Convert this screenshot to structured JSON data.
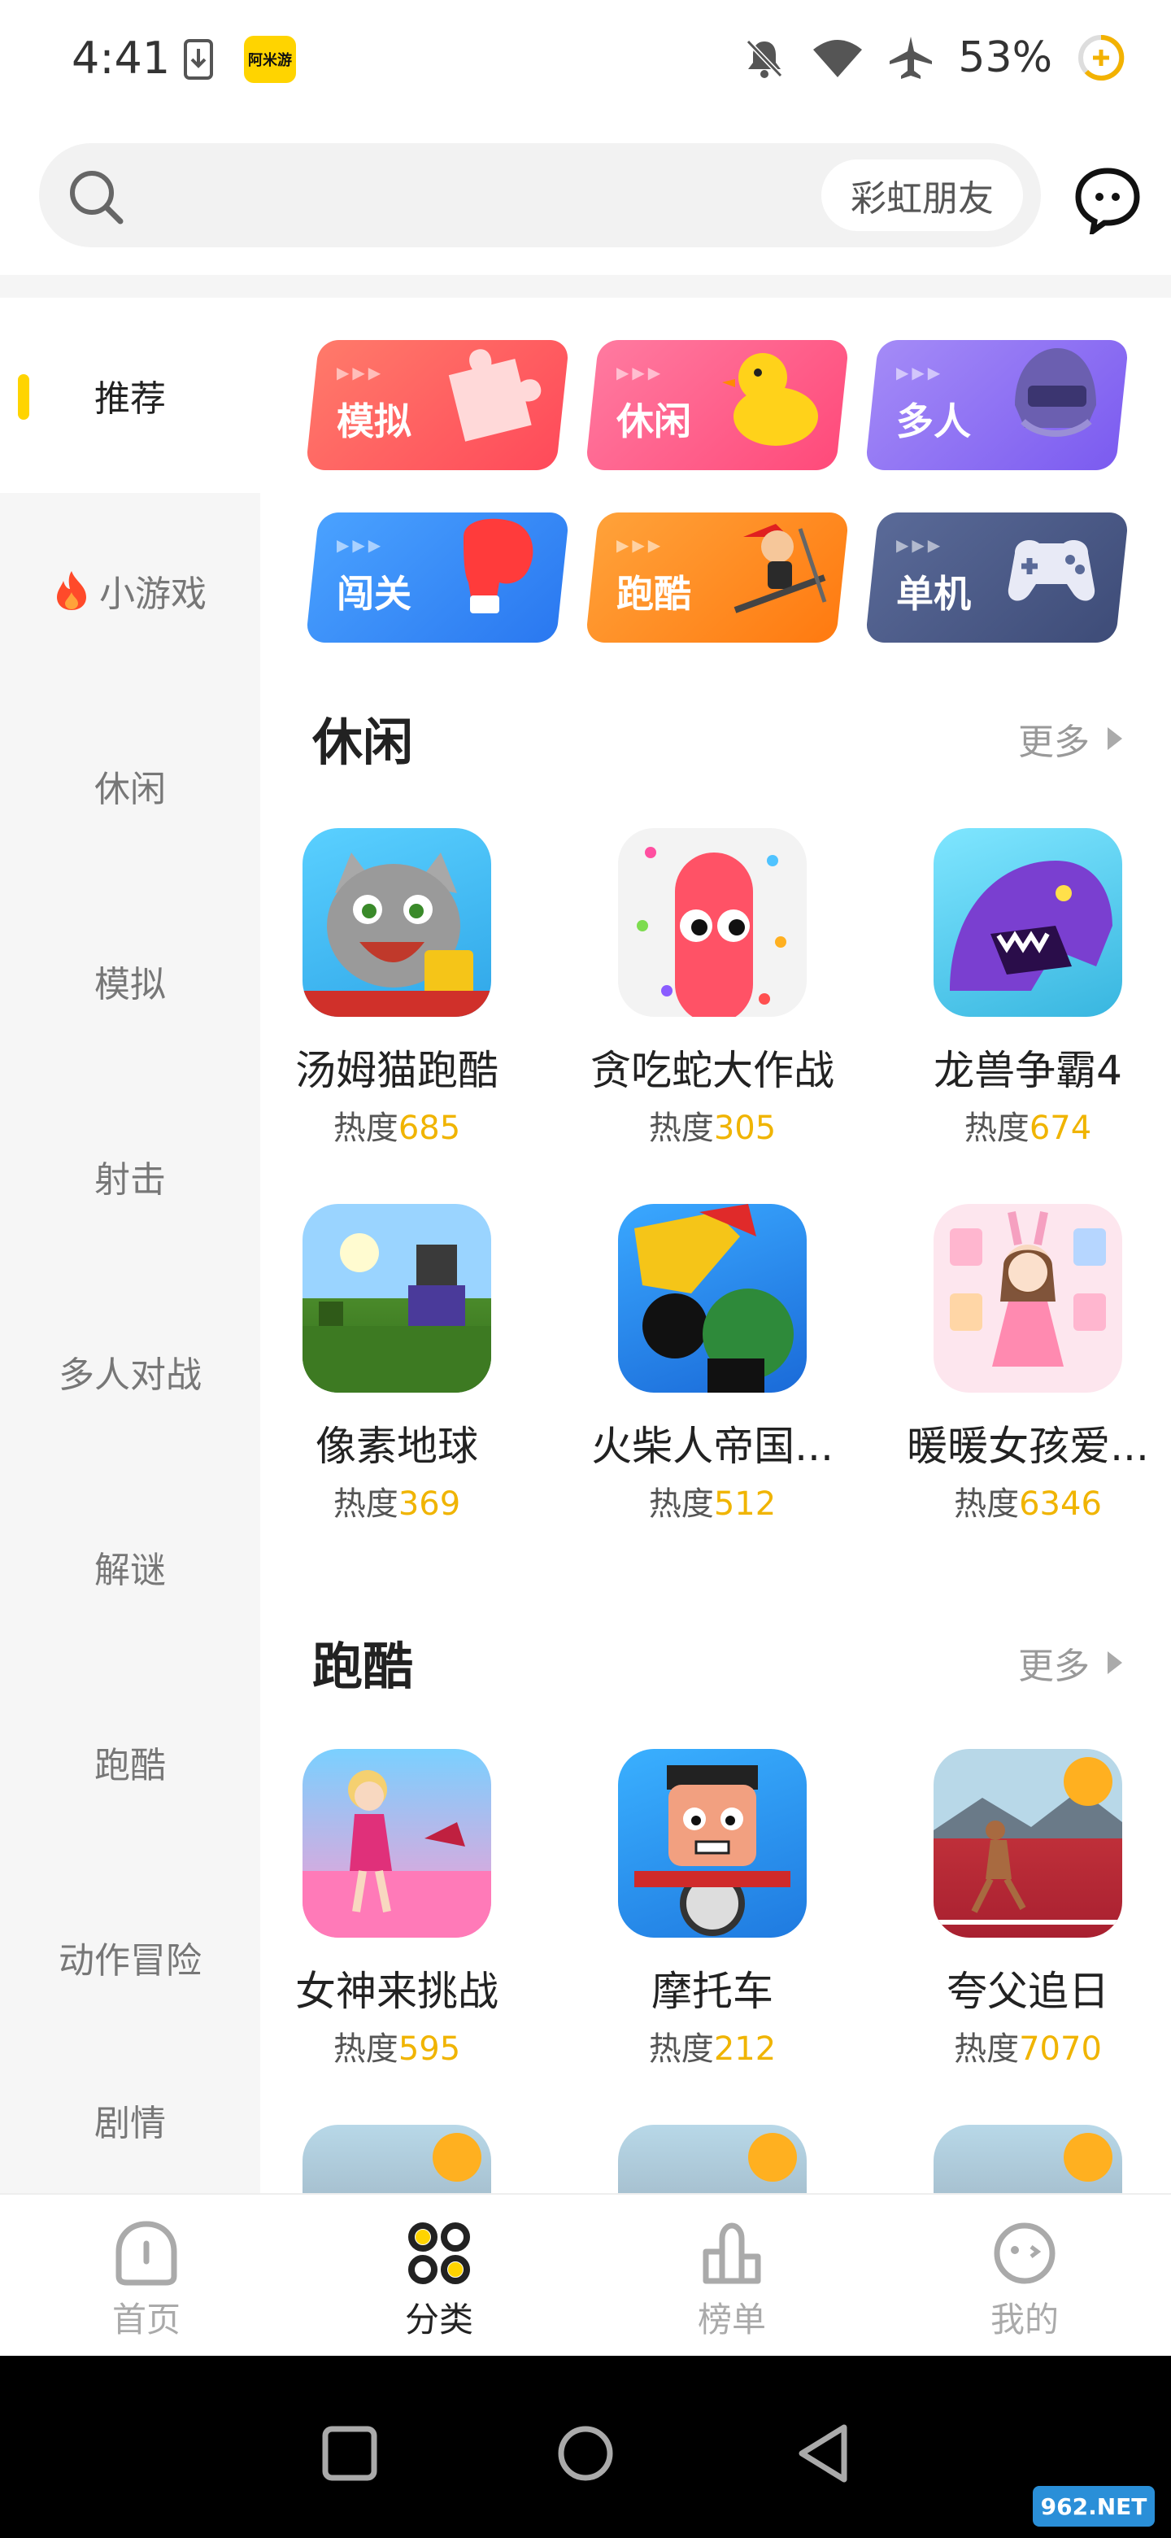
{
  "status": {
    "time": "4:41",
    "app_badge": "阿米游",
    "battery": "53%"
  },
  "search": {
    "chip": "彩虹朋友"
  },
  "sidebar": {
    "items": [
      {
        "label": "推荐"
      },
      {
        "label": "小游戏"
      },
      {
        "label": "休闲"
      },
      {
        "label": "模拟"
      },
      {
        "label": "射击"
      },
      {
        "label": "多人对战"
      },
      {
        "label": "解谜"
      },
      {
        "label": "跑酷"
      },
      {
        "label": "动作冒险"
      },
      {
        "label": "剧情"
      }
    ]
  },
  "tiles": [
    {
      "label": "模拟",
      "color": "#ff5e5e"
    },
    {
      "label": "休闲",
      "color": "#ff5c8a"
    },
    {
      "label": "多人",
      "color": "#8b6cf2"
    },
    {
      "label": "闯关",
      "color": "#2f8cf5"
    },
    {
      "label": "跑酷",
      "color": "#ff8a1f"
    },
    {
      "label": "单机",
      "color": "#4a5a86"
    }
  ],
  "sections": [
    {
      "title": "休闲",
      "more": "更多",
      "games": [
        {
          "name": "汤姆猫跑酷",
          "heat_label": "热度",
          "heat": "685"
        },
        {
          "name": "贪吃蛇大作战",
          "heat_label": "热度",
          "heat": "305"
        },
        {
          "name": "龙兽争霸4",
          "heat_label": "热度",
          "heat": "674"
        },
        {
          "name": "像素地球",
          "heat_label": "热度",
          "heat": "369"
        },
        {
          "name": "火柴人帝国...",
          "heat_label": "热度",
          "heat": "512"
        },
        {
          "name": "暖暖女孩爱...",
          "heat_label": "热度",
          "heat": "6346"
        }
      ]
    },
    {
      "title": "跑酷",
      "more": "更多",
      "games": [
        {
          "name": "女神来挑战",
          "heat_label": "热度",
          "heat": "595"
        },
        {
          "name": "摩托车",
          "heat_label": "热度",
          "heat": "212"
        },
        {
          "name": "夸父追日",
          "heat_label": "热度",
          "heat": "7070"
        }
      ]
    }
  ],
  "bottom_nav": [
    {
      "label": "首页"
    },
    {
      "label": "分类"
    },
    {
      "label": "榜单"
    },
    {
      "label": "我的"
    }
  ],
  "watermark": "962.NET"
}
